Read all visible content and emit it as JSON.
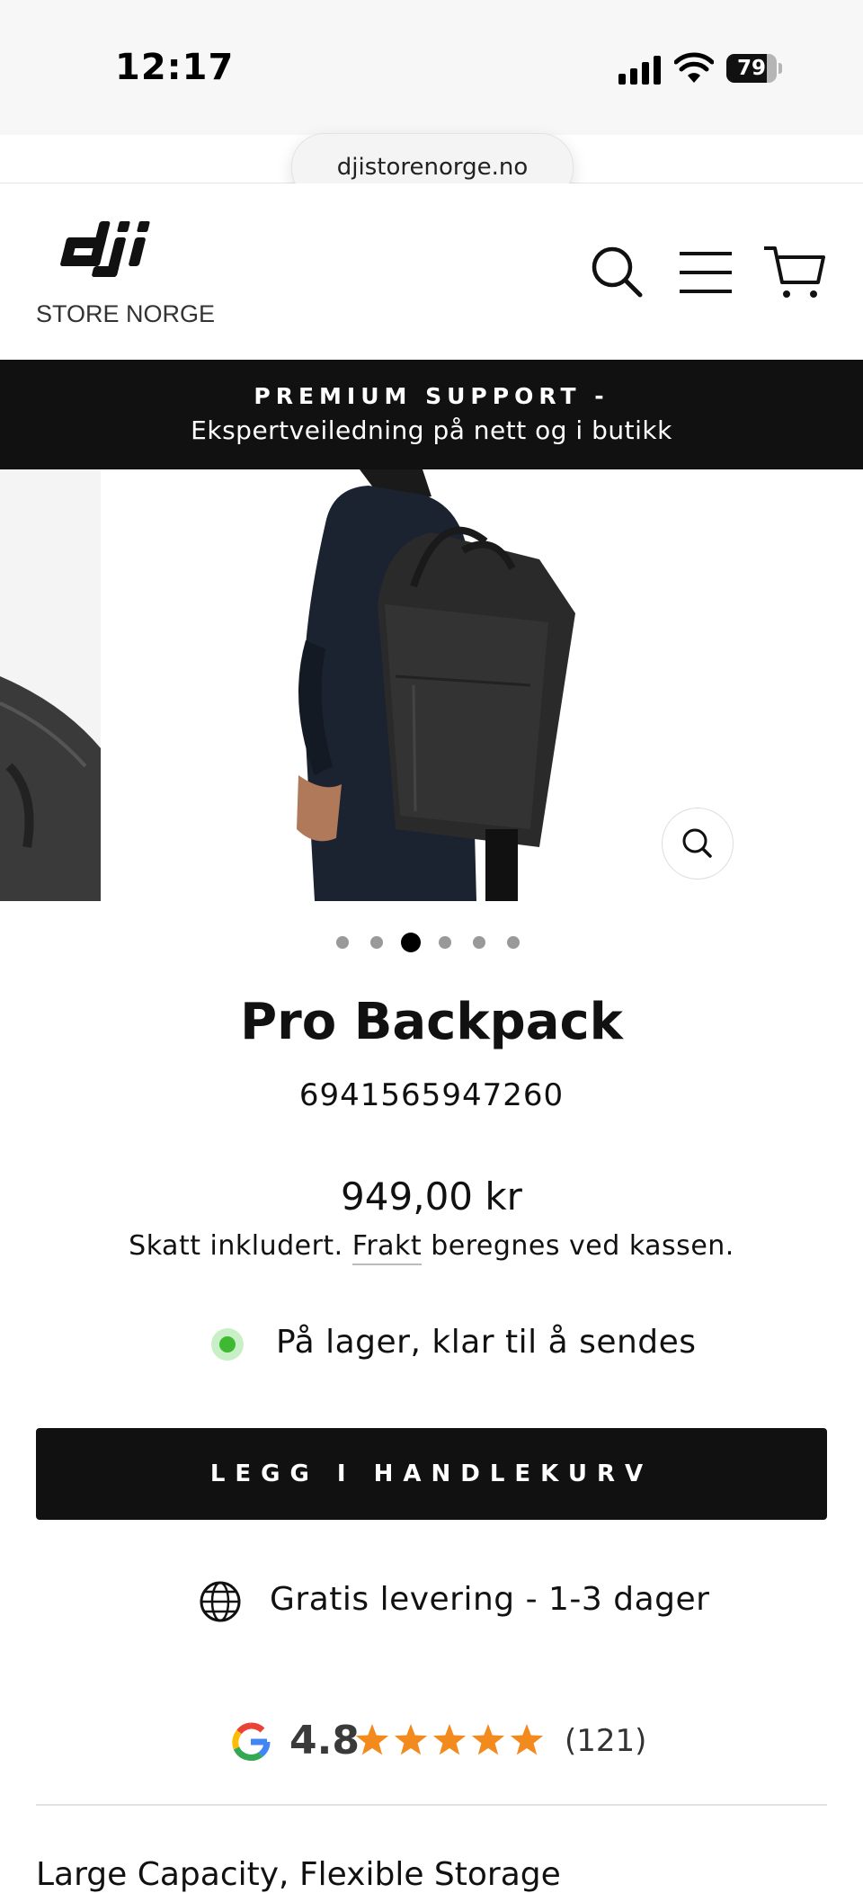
{
  "status_bar": {
    "time": "12:17",
    "battery": "79"
  },
  "browser": {
    "url": "djistorenorge.no"
  },
  "header": {
    "logo_subtitle": "STORE NORGE"
  },
  "banner": {
    "line1": "PREMIUM SUPPORT -",
    "line2": "Ekspertveiledning på nett og i butikk"
  },
  "gallery": {
    "active_index": 3,
    "total": 6
  },
  "product": {
    "title": "Pro Backpack",
    "sku": "6941565947260",
    "price": "949,00 kr",
    "tax_prefix": "Skatt inkludert. ",
    "tax_link": "Frakt",
    "tax_suffix": " beregnes ved kassen.",
    "stock": "På lager, klar til å sendes",
    "add_to_cart": "LEGG I HANDLEKURV",
    "delivery": "Gratis levering - 1-3 dager"
  },
  "reviews": {
    "score": "4.8",
    "stars": 5,
    "count": "(121)"
  },
  "feature_heading": "Large Capacity, Flexible Storage",
  "colors": {
    "accent": "#111111",
    "star": "#f28a1e",
    "stock_green": "#3fb832"
  }
}
